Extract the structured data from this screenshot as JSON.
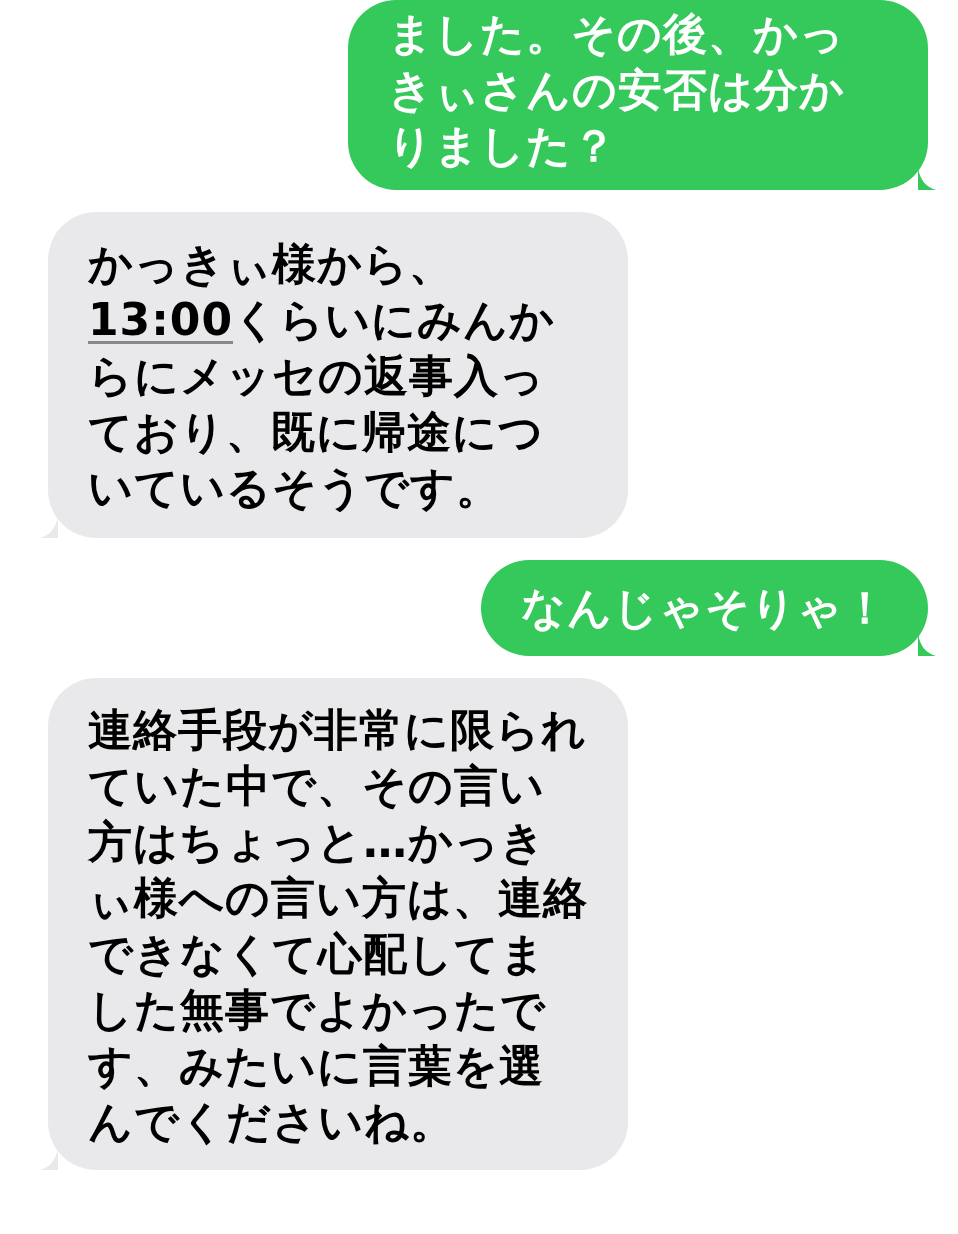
{
  "messages": [
    {
      "kind": "sent",
      "parts": [
        {
          "kind": "text",
          "text": "ました。その後、かっきぃさんの安否は分かりました？"
        }
      ]
    },
    {
      "kind": "received",
      "parts": [
        {
          "kind": "text",
          "text": "かっきぃ様から、"
        },
        {
          "kind": "link",
          "text": "13:00"
        },
        {
          "kind": "text",
          "text": "くらいにみんからにメッセの返事入っており、既に帰途についているそうです。"
        }
      ]
    },
    {
      "kind": "sent",
      "parts": [
        {
          "kind": "text",
          "text": "なんじゃそりゃ！"
        }
      ]
    },
    {
      "kind": "received",
      "parts": [
        {
          "kind": "text",
          "text": "連絡手段が非常に限られていた中で、その言い方はちょっと…かっきぃ様への言い方は、連絡できなくて心配してました無事でよかったです、みたいに言葉を選んでくださいね。"
        }
      ]
    }
  ]
}
